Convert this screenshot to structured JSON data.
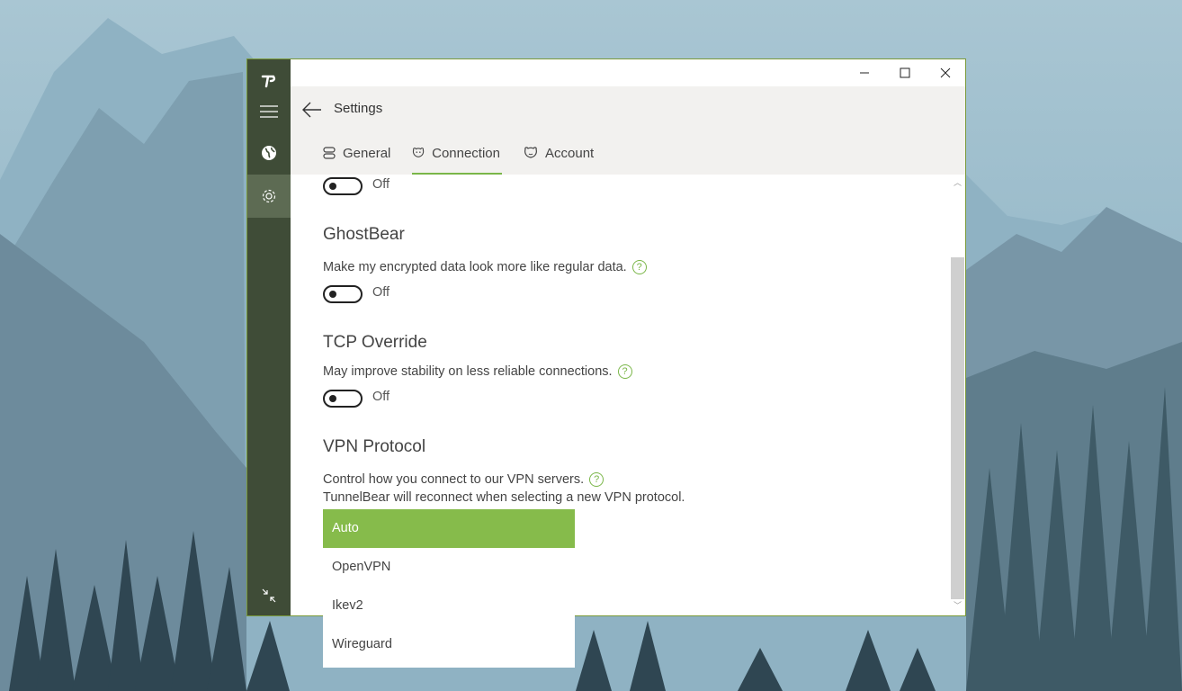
{
  "app": {
    "logo_icon": "tunnelbear-logo-icon",
    "accent_color": "#86bb4b",
    "rail_color": "#3f4c37"
  },
  "rail": {
    "items": [
      {
        "icon": "hamburger-menu-icon"
      },
      {
        "icon": "globe-icon"
      },
      {
        "icon": "gear-icon",
        "active": true
      }
    ],
    "bottom_icon": "compact-mode-icon"
  },
  "window_controls": [
    "minimize-icon",
    "maximize-icon",
    "close-icon"
  ],
  "header": {
    "title": "Settings",
    "tabs": [
      {
        "label": "General",
        "icon": "general-icon"
      },
      {
        "label": "Connection",
        "icon": "bear-icon",
        "active": true
      },
      {
        "label": "Account",
        "icon": "bear-face-icon"
      }
    ]
  },
  "settings": {
    "top_toggle": {
      "state_label": "Off"
    },
    "ghostbear": {
      "title": "GhostBear",
      "description": "Make my encrypted data look more like regular data.",
      "state_label": "Off"
    },
    "tcp_override": {
      "title": "TCP Override",
      "description": "May improve stability on less reliable connections.",
      "state_label": "Off"
    },
    "vpn_protocol": {
      "title": "VPN Protocol",
      "description_line1": "Control how you connect to our VPN servers.",
      "description_line2": "TunnelBear will reconnect when selecting a new VPN protocol.",
      "options": [
        "Auto",
        "OpenVPN",
        "Ikev2",
        "Wireguard"
      ],
      "selected": "Auto"
    }
  }
}
